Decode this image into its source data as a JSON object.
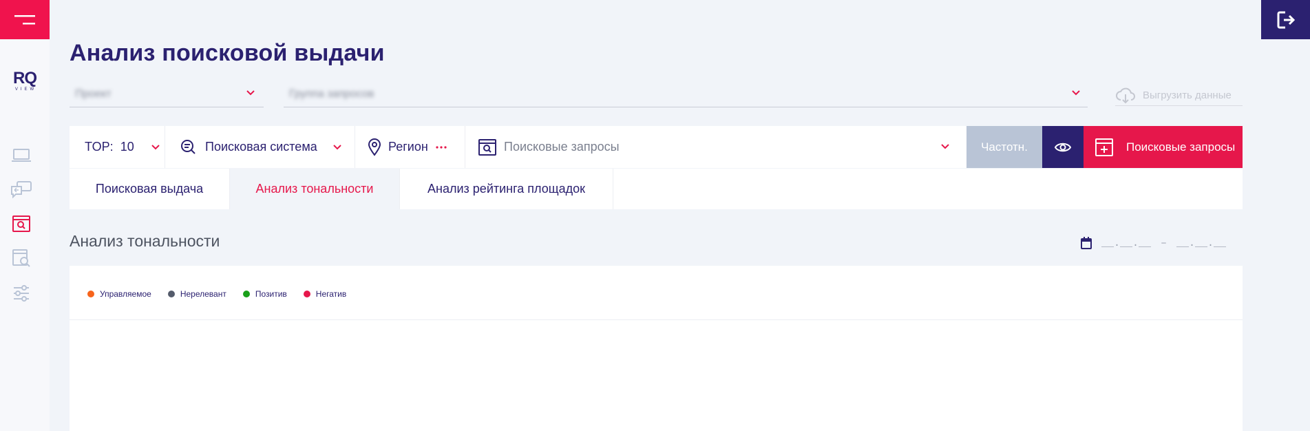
{
  "app": {
    "logo_main": "RQ",
    "logo_sub": "VIEW"
  },
  "page": {
    "title": "Анализ поисковой выдачи"
  },
  "project_select": {
    "value": "Проект",
    "query_group": "Группа запросов"
  },
  "export": {
    "label": "Выгрузить данные"
  },
  "filters": {
    "top_label": "TOP:",
    "top_value": "10",
    "search_engine": "Поисковая система",
    "region": "Регион",
    "queries_placeholder": "Поисковые запросы",
    "freq_button": "Частотн.",
    "queries_button": "Поисковые запросы"
  },
  "tabs": [
    {
      "label": "Поисковая выдача"
    },
    {
      "label": "Анализ тональности"
    },
    {
      "label": "Анализ рейтинга площадок"
    }
  ],
  "section": {
    "title": "Анализ тональности"
  },
  "date_range": {
    "from": "__.__.__",
    "sep": "–",
    "to": "__.__.__"
  },
  "legend": [
    {
      "label": "Управляемое",
      "color": "#f7641b"
    },
    {
      "label": "Нерелевант",
      "color": "#545b6b"
    },
    {
      "label": "Позитив",
      "color": "#1aa01a"
    },
    {
      "label": "Негатив",
      "color": "#e6174b"
    }
  ],
  "colors": {
    "accent": "#e6174b",
    "brand": "#2b2170",
    "muted_button": "#b9c4d6"
  }
}
